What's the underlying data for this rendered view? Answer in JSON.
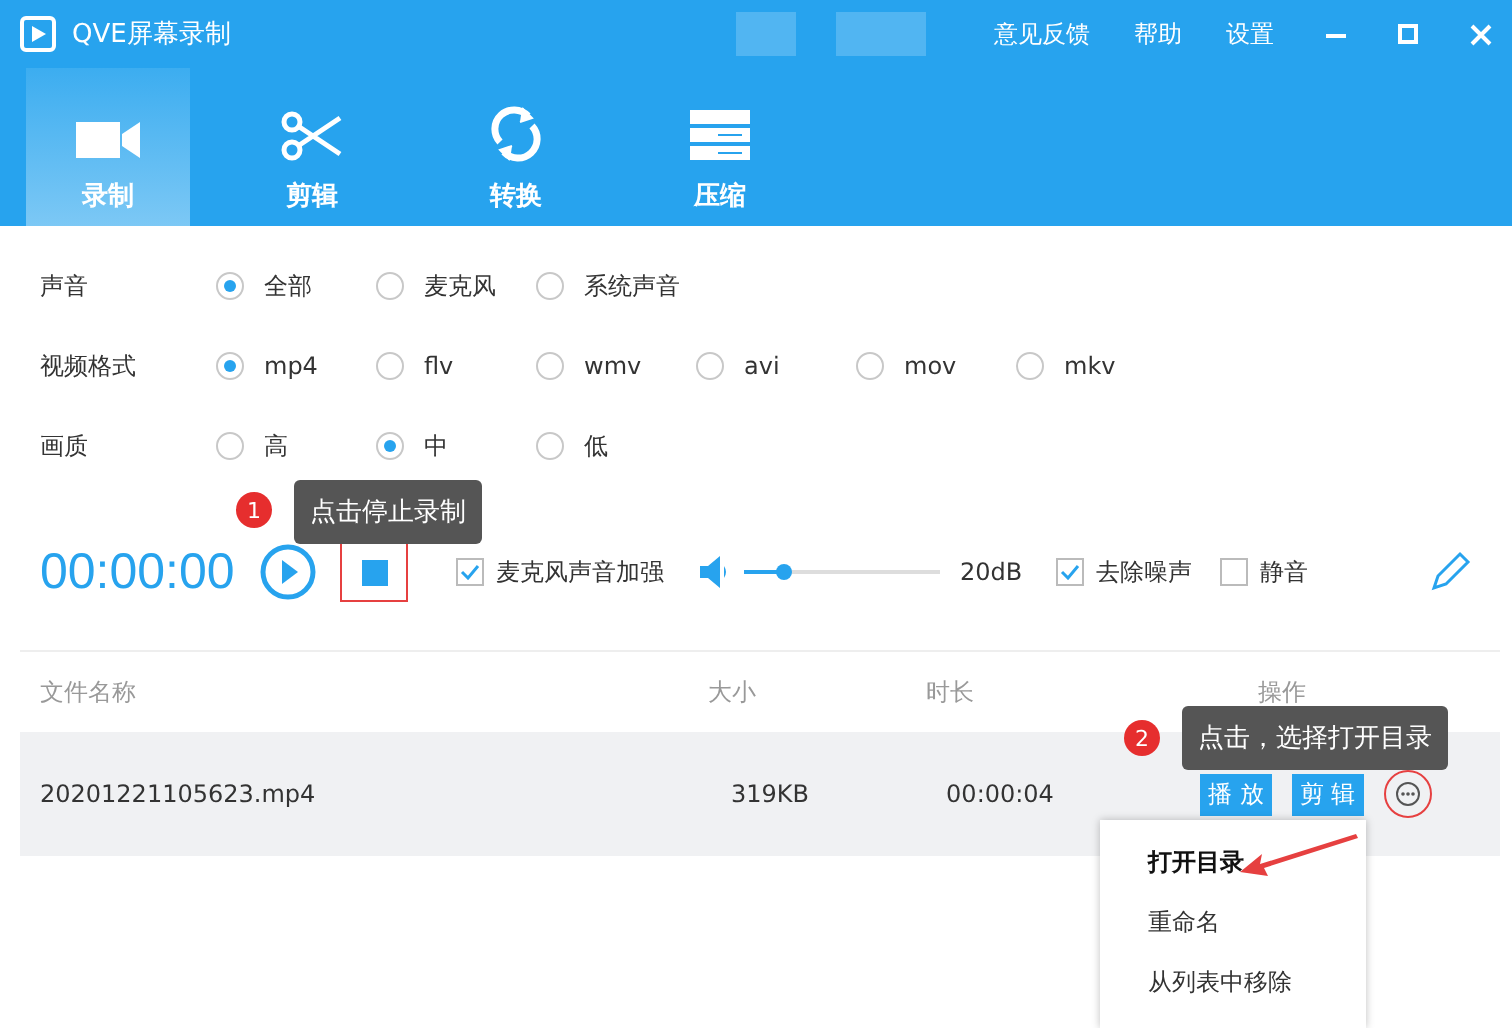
{
  "window": {
    "title": "QVE屏幕录制",
    "menu": [
      "意见反馈",
      "帮助",
      "设置"
    ]
  },
  "tabs": [
    {
      "label": "录制",
      "kind": "record",
      "selected": true
    },
    {
      "label": "剪辑",
      "kind": "cut",
      "selected": false
    },
    {
      "label": "转换",
      "kind": "convert",
      "selected": false
    },
    {
      "label": "压缩",
      "kind": "compress",
      "selected": false
    }
  ],
  "options": [
    {
      "label": "声音",
      "choices": [
        {
          "label": "全部",
          "selected": true
        },
        {
          "label": "麦克风",
          "selected": false
        },
        {
          "label": "系统声音",
          "selected": false
        }
      ]
    },
    {
      "label": "视频格式",
      "choices": [
        {
          "label": "mp4",
          "selected": true
        },
        {
          "label": "flv",
          "selected": false
        },
        {
          "label": "wmv",
          "selected": false
        },
        {
          "label": "avi",
          "selected": false
        },
        {
          "label": "mov",
          "selected": false
        },
        {
          "label": "mkv",
          "selected": false
        }
      ]
    },
    {
      "label": "画质",
      "choices": [
        {
          "label": "高",
          "selected": false
        },
        {
          "label": "中",
          "selected": true
        },
        {
          "label": "低",
          "selected": false
        }
      ]
    }
  ],
  "recorder": {
    "time": "00:00:00",
    "mic_boost": {
      "label": "麦克风声音加强",
      "checked": true
    },
    "volume": {
      "level": 0.2,
      "reading": "20dB"
    },
    "denoise": {
      "label": "去除噪声",
      "checked": true
    },
    "mute": {
      "label": "静音",
      "checked": false
    }
  },
  "table": {
    "columns": [
      "文件名称",
      "大小",
      "时长",
      "操作"
    ],
    "rows": [
      {
        "cells": [
          "20201221105623.mp4",
          "319KB",
          "00:00:04"
        ],
        "actions": [
          "播 放",
          "剪 辑"
        ]
      }
    ]
  },
  "context_menu": {
    "items": [
      {
        "label": "打开目录",
        "selected": true
      },
      {
        "label": "重命名",
        "selected": false
      },
      {
        "label": "从列表中移除",
        "selected": false
      }
    ]
  },
  "callouts": [
    {
      "number": "1",
      "text": "点击停止录制"
    },
    {
      "number": "2",
      "text": "点击，选择打开目录"
    }
  ]
}
